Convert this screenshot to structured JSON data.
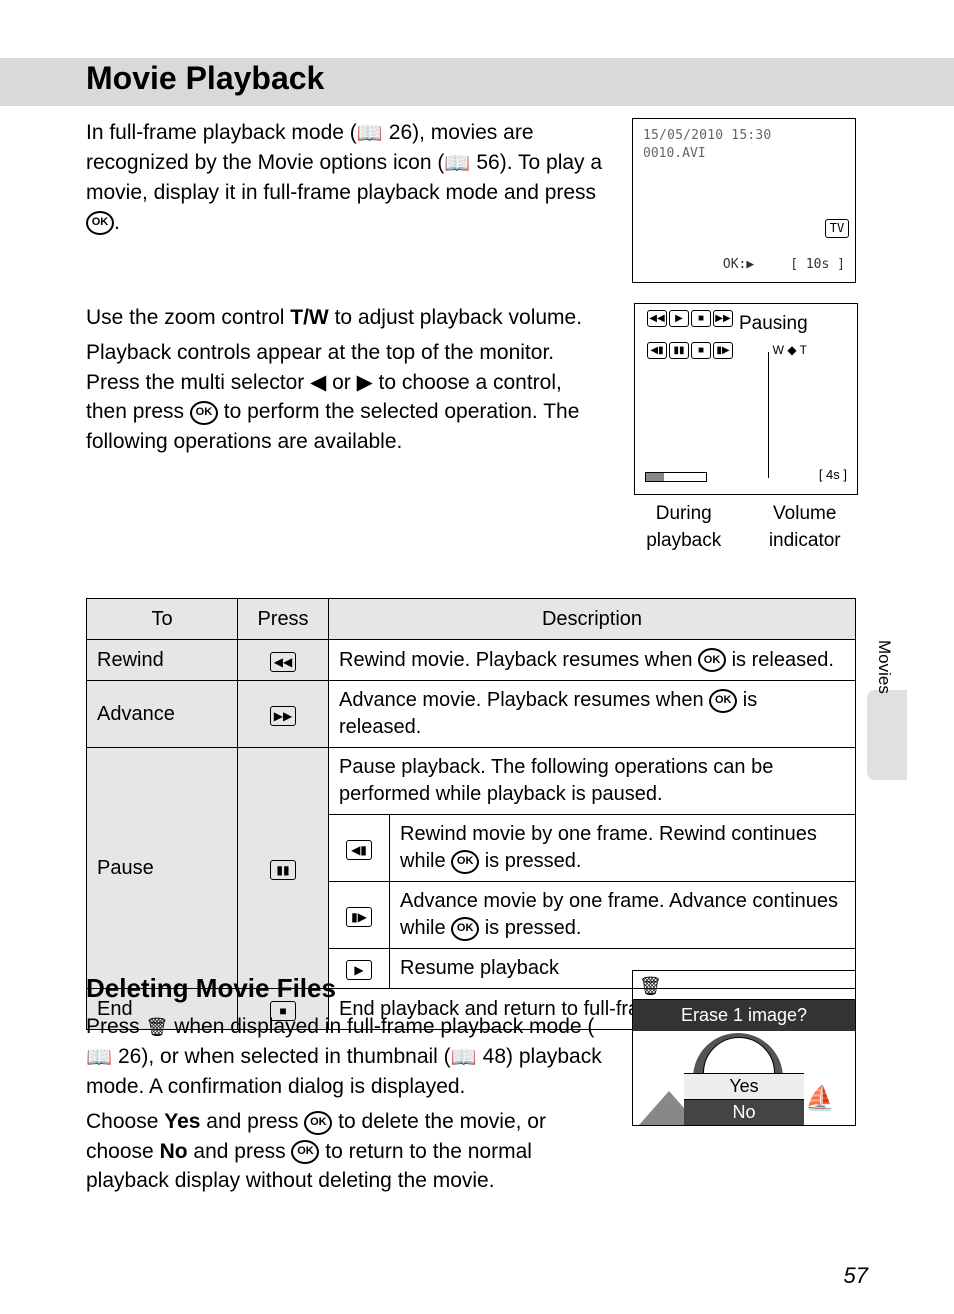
{
  "header": {
    "title": "Movie Playback"
  },
  "side_tab": "Movies",
  "page_number": "57",
  "intro": {
    "p1a": "In full-frame playback mode (",
    "p1_ref1": " 26), movies are recognized by the Movie options icon (",
    "p1_ref2": " 56). To play a movie, display it in full-frame playback mode and press ",
    "p1_end": "."
  },
  "screen1": {
    "timestamp": "15/05/2010 15:30",
    "filename": "0010.AVI",
    "tv": "TV",
    "ok_play": "OK:▶",
    "bracket": "[   10s ]"
  },
  "zoom": {
    "p1a": "Use the zoom control ",
    "tw": "T/W",
    "p1b": " to adjust playback volume.",
    "p2a": "Playback controls appear at the top of the monitor. Press the multi selector ◀ or ▶ to choose a control, then press ",
    "p2b": " to perform the selected operation. The following operations are available."
  },
  "screen2": {
    "pausing": "Pausing",
    "wt": "W ◆ T",
    "time": "[     4s ]",
    "caption_during": "During playback",
    "caption_volume": "Volume indicator"
  },
  "table": {
    "head": {
      "to": "To",
      "press": "Press",
      "desc": "Description"
    },
    "rows": {
      "rewind": {
        "label": "Rewind",
        "icon": "◀◀",
        "desc_a": "Rewind movie. Playback resumes when ",
        "desc_b": " is released."
      },
      "advance": {
        "label": "Advance",
        "icon": "▶▶",
        "desc_a": "Advance movie. Playback resumes when ",
        "desc_b": " is released."
      },
      "pause": {
        "label": "Pause",
        "icon": "▮▮",
        "desc_top": "Pause playback. The following operations can be performed while playback is paused.",
        "sub1": {
          "icon": "◀▮",
          "desc_a": "Rewind movie by one frame. Rewind continues while ",
          "desc_b": " is pressed."
        },
        "sub2": {
          "icon": "▮▶",
          "desc_a": "Advance movie by one frame. Advance continues while ",
          "desc_b": " is pressed."
        },
        "sub3": {
          "icon": "▶",
          "desc": "Resume playback"
        }
      },
      "end": {
        "label": "End",
        "icon": "■",
        "desc": "End playback and return to full-frame playback."
      }
    }
  },
  "deleting": {
    "heading": "Deleting Movie Files",
    "p1a": "Press ",
    "p1b": " when displayed in full-frame playback mode (",
    "p1c": " 26), or when selected in thumbnail (",
    "p1d": " 48) playback mode. A confirmation dialog is displayed.",
    "p2a": "Choose ",
    "yes": "Yes",
    "p2b": " and press ",
    "p2c": " to delete the movie, or choose ",
    "no": "No",
    "p2d": " and press ",
    "p2e": " to return to the normal playback display without deleting the movie."
  },
  "erase_panel": {
    "title": "Erase 1 image?",
    "yes": "Yes",
    "no": "No"
  },
  "glyphs": {
    "ok": "OK",
    "book": "📖",
    "trash": "🗑",
    "boat": "⛵"
  }
}
